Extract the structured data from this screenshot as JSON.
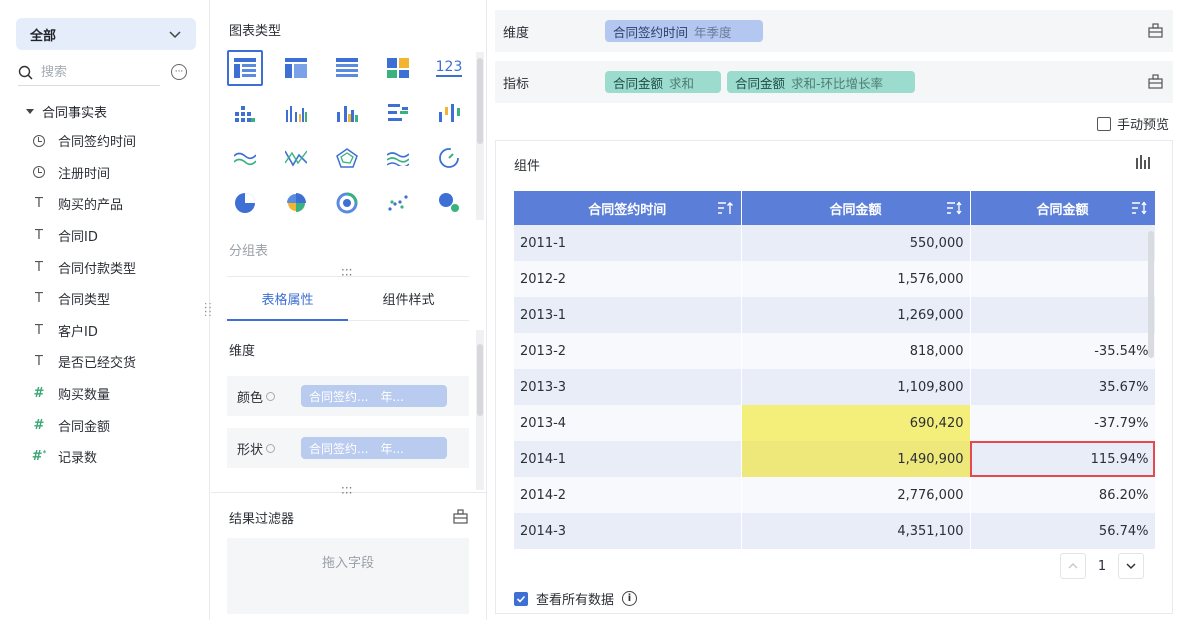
{
  "left": {
    "scope_label": "全部",
    "search_placeholder": "搜索",
    "table_name": "合同事实表",
    "fields": [
      {
        "type": "time",
        "label": "合同签约时间"
      },
      {
        "type": "time",
        "label": "注册时间"
      },
      {
        "type": "text",
        "label": "购买的产品"
      },
      {
        "type": "text",
        "label": "合同ID"
      },
      {
        "type": "text",
        "label": "合同付款类型"
      },
      {
        "type": "text",
        "label": "合同类型"
      },
      {
        "type": "text",
        "label": "客户ID"
      },
      {
        "type": "text",
        "label": "是否已经交货"
      },
      {
        "type": "number",
        "label": "购买数量"
      },
      {
        "type": "number",
        "label": "合同金额"
      },
      {
        "type": "count",
        "label": "记录数"
      }
    ]
  },
  "middle": {
    "chart_type_title": "图表类型",
    "chart_types": [
      "grouped-table-icon",
      "detail-table-icon",
      "cross-table-icon",
      "kpi-block-icon",
      "number-card-icon",
      "dot-column-icon",
      "multi-column-icon",
      "column-icon",
      "bar-icon",
      "waterfall-icon",
      "area-icon",
      "line-icon",
      "radar-icon",
      "stacked-area-icon",
      "gauge-icon",
      "pie-icon",
      "rose-pie-icon",
      "ring-icon",
      "scatter-icon",
      "bubble-icon"
    ],
    "number_card_text": "123",
    "selected_chart_label": "分组表",
    "tabs": {
      "table_props": "表格属性",
      "component_style": "组件样式"
    },
    "prop_section": "维度",
    "color_label": "颜色",
    "shape_label": "形状",
    "dim_pill_name": "合同签约...",
    "dim_pill_agg": "年...",
    "result_filter": "结果过滤器",
    "drop_hint": "拖入字段"
  },
  "right": {
    "dimension_label": "维度",
    "dimension_pill": {
      "name": "合同签约时间",
      "agg": "年季度"
    },
    "measure_label": "指标",
    "measure_pills": [
      {
        "name": "合同金额",
        "agg": "求和"
      },
      {
        "name": "合同金额",
        "agg": "求和-环比增长率"
      }
    ],
    "manual_preview": "手动预览",
    "component_title": "组件",
    "table": {
      "headers": [
        "合同签约时间",
        "合同金额",
        "合同金额"
      ],
      "rows": [
        [
          "2011-1",
          "550,000",
          ""
        ],
        [
          "2012-2",
          "1,576,000",
          ""
        ],
        [
          "2013-1",
          "1,269,000",
          ""
        ],
        [
          "2013-2",
          "818,000",
          "-35.54%"
        ],
        [
          "2013-3",
          "1,109,800",
          "35.67%"
        ],
        [
          "2013-4",
          "690,420",
          "-37.79%"
        ],
        [
          "2014-1",
          "1,490,900",
          "115.94%"
        ],
        [
          "2014-2",
          "2,776,000",
          "86.20%"
        ],
        [
          "2014-3",
          "4,351,100",
          "56.74%"
        ]
      ]
    },
    "page_number": "1",
    "view_all": "查看所有数据",
    "colors": {
      "header": "#5b7fd9",
      "highlight": "#f4ee7a",
      "alert_border": "#e5484d",
      "accent": "#3d6fd5"
    }
  }
}
